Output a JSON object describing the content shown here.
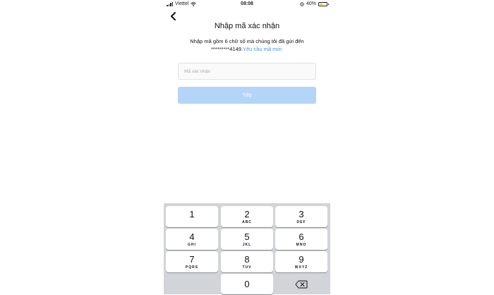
{
  "status_bar": {
    "carrier": "Viettel",
    "time": "08:08",
    "battery_percent": "40%",
    "battery_level": 0.4,
    "battery_color": "#f0c419"
  },
  "header": {
    "back_icon": "chevron-left-icon",
    "title": "Nhập mã xác nhận"
  },
  "description": {
    "line1": "Nhập mã gồm 6 chữ số mà chúng tôi đã gửi đến",
    "masked_phone": "*********4149.",
    "resend_link": "Yêu cầu mã mới."
  },
  "code_input": {
    "placeholder": "Mã xác nhận",
    "value": ""
  },
  "next_button": {
    "label": "Tiếp",
    "color": "#b2d5f8"
  },
  "keypad": {
    "keys": [
      {
        "num": "1",
        "letters": ""
      },
      {
        "num": "2",
        "letters": "ABC"
      },
      {
        "num": "3",
        "letters": "DEF"
      },
      {
        "num": "4",
        "letters": "GHI"
      },
      {
        "num": "5",
        "letters": "JKL"
      },
      {
        "num": "6",
        "letters": "MNO"
      },
      {
        "num": "7",
        "letters": "PQRS"
      },
      {
        "num": "8",
        "letters": "TUV"
      },
      {
        "num": "9",
        "letters": "WXYZ"
      },
      {
        "num": "0",
        "letters": ""
      }
    ],
    "delete_icon": "backspace-icon",
    "accent": "#3897f0"
  }
}
